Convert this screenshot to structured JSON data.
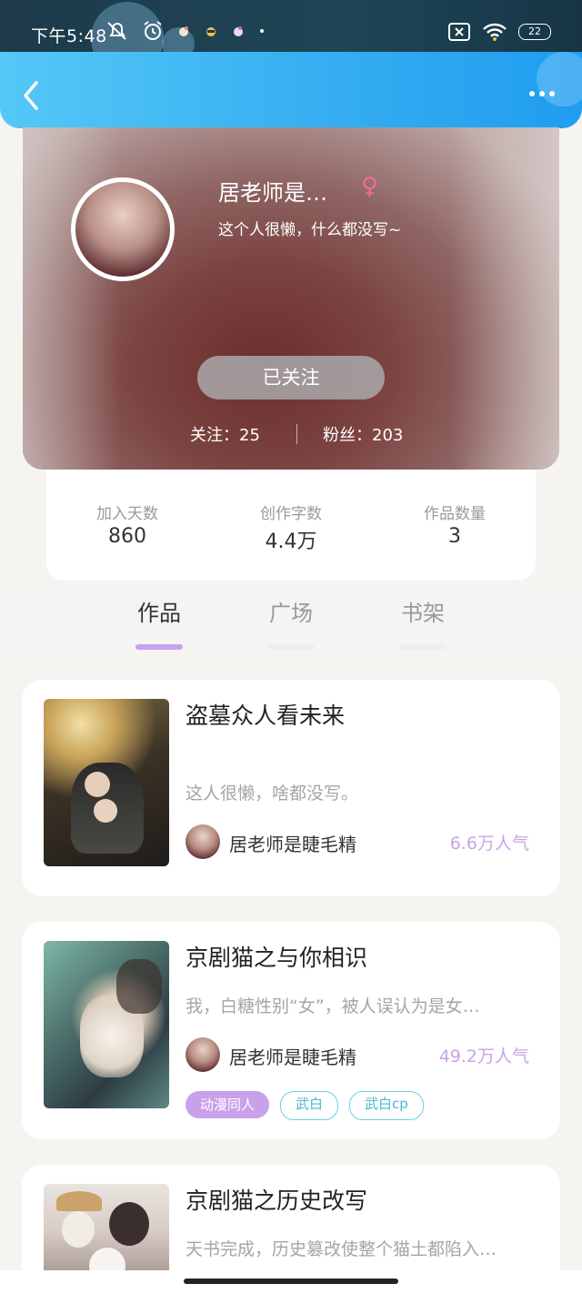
{
  "status_bar": {
    "time": "下午5:48",
    "battery": "22",
    "icons": [
      "mute-icon",
      "alarm-icon",
      "app-notify-icon",
      "app-notify-icon",
      "app-notify-icon",
      "dot-icon",
      "sim-off-icon",
      "wifi-icon",
      "battery-icon"
    ]
  },
  "header": {
    "back_icon": "chevron-left-icon",
    "more_icon": "more-horizontal-icon"
  },
  "profile": {
    "name": "居老师是…",
    "gender_symbol": "♀",
    "bio": "这个人很懒，什么都没写~",
    "follow_button": "已关注",
    "following": "关注：25",
    "fans": "粉丝：203"
  },
  "stats": [
    {
      "label": "加入天数",
      "value": "860"
    },
    {
      "label": "创作字数",
      "value": "4.4万"
    },
    {
      "label": "作品数量",
      "value": "3"
    }
  ],
  "tabs": [
    {
      "label": "作品",
      "active": true
    },
    {
      "label": "广场",
      "active": false
    },
    {
      "label": "书架",
      "active": false
    }
  ],
  "works": [
    {
      "title": "盗墓众人看未来",
      "description": "这人很懒，啥都没写。",
      "author": "居老师是睫毛精",
      "popularity": "6.6万人气",
      "tags": []
    },
    {
      "title": "京剧猫之与你相识",
      "description": "我，白糖性别“女”，被人误认为是女…",
      "author": "居老师是睫毛精",
      "popularity": "49.2万人气",
      "tags": [
        "动漫同人",
        "武白",
        "武白cp"
      ]
    },
    {
      "title": "京剧猫之历史改写",
      "description": "天书完成，历史篡改使整个猫土都陷入…",
      "author": "",
      "popularity": "",
      "tags": []
    }
  ],
  "colors": {
    "header_blue": "#2ea8f0",
    "accent_purple": "#c9a0ea",
    "tag_cyan": "#6ccfe0",
    "gender_pink": "#f06a99"
  }
}
